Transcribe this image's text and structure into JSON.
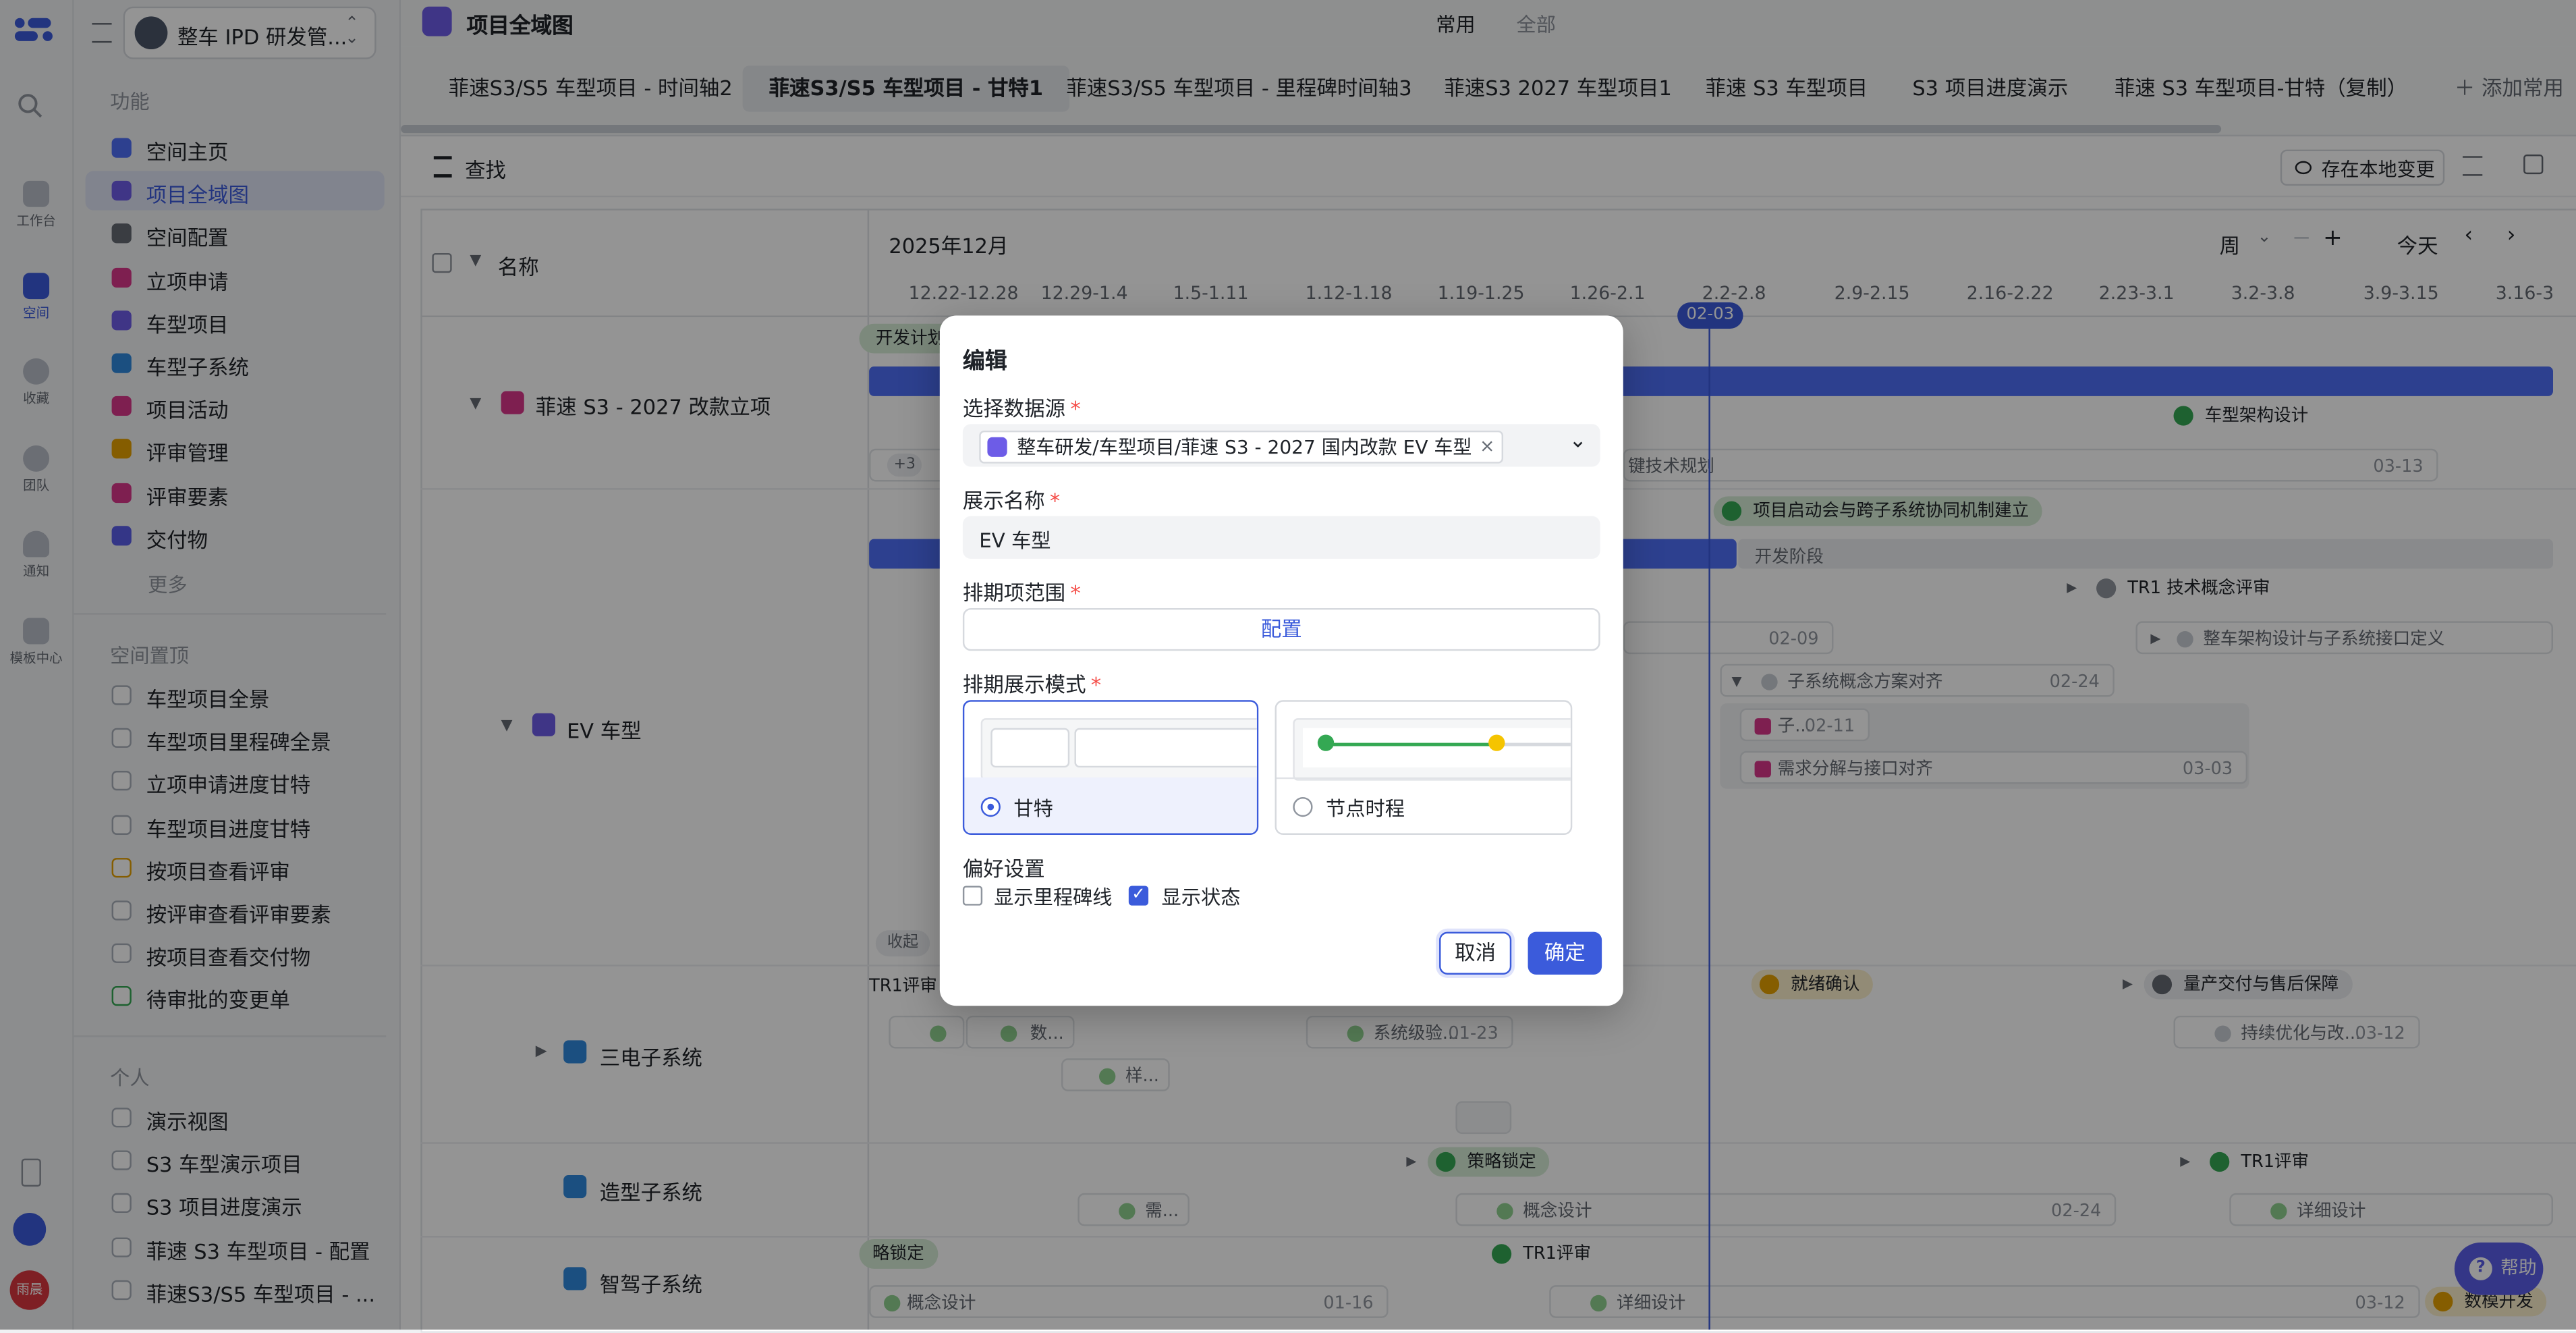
{
  "rail": {
    "items": [
      {
        "label": "工作台",
        "icon": "home-icon"
      },
      {
        "label": "空间",
        "icon": "space-icon"
      },
      {
        "label": "收藏",
        "icon": "star-icon"
      },
      {
        "label": "团队",
        "icon": "team-icon"
      },
      {
        "label": "通知",
        "icon": "bell-icon"
      },
      {
        "label": "模板中心",
        "icon": "template-icon"
      }
    ],
    "avatar": "雨晨"
  },
  "sidebar": {
    "space_name": "整车 IPD 研发管...",
    "features_title": "功能",
    "features": [
      {
        "label": "空间主页",
        "color": "#4f6ef7"
      },
      {
        "label": "项目全域图",
        "color": "#6d5ce7"
      },
      {
        "label": "空间配置",
        "color": "#646a73"
      },
      {
        "label": "立项申请",
        "color": "#d9368b"
      },
      {
        "label": "车型项目",
        "color": "#6d5ce7"
      },
      {
        "label": "车型子系统",
        "color": "#2f88dc"
      },
      {
        "label": "项目活动",
        "color": "#d9368b"
      },
      {
        "label": "评审管理",
        "color": "#e5a000"
      },
      {
        "label": "评审要素",
        "color": "#d9368b"
      },
      {
        "label": "交付物",
        "color": "#5b5ee8"
      }
    ],
    "more": "更多",
    "pinned_title": "空间置顶",
    "pinned": [
      "车型项目全景",
      "车型项目里程碑全景",
      "立项申请进度甘特",
      "车型项目进度甘特",
      "按项目查看评审",
      "按评审查看评审要素",
      "按项目查看交付物",
      "待审批的变更单"
    ],
    "personal_title": "个人",
    "personal": [
      "演示视图",
      "S3 车型演示项目",
      "S3 项目进度演示",
      "菲速 S3 车型项目 - 配置",
      "菲速S3/S5 车型项目 - ..."
    ]
  },
  "page": {
    "title": "项目全域图",
    "tab_common": "常用",
    "tab_all": "全部",
    "view_tabs": [
      "菲速S3/S5 车型项目 - 时间轴2",
      "菲速S3/S5 车型项目 - 甘特1",
      "菲速S3/S5 车型项目 - 里程碑时间轴3",
      "菲速S3 2027 车型项目1",
      "菲速 S3 车型项目",
      "S3 项目进度演示",
      "菲速 S3 车型项目-甘特（复制）"
    ],
    "add_common": "添加常用",
    "search": "查找",
    "save_local": "存在本地变更"
  },
  "gantt": {
    "name_header": "名称",
    "month": "2025年12月",
    "unit": "周",
    "today": "今天",
    "weeks": [
      "12.22-12.28",
      "12.29-1.4",
      "1.5-1.11",
      "1.12-1.18",
      "1.19-1.25",
      "1.26-2.1",
      "2.2-2.8",
      "2.9-2.15",
      "2.16-2.22",
      "2.23-3.1",
      "3.2-3.8",
      "3.9-3.15",
      "3.16-3"
    ],
    "today_marker": "02-03",
    "rows": {
      "project": "菲速 S3 - 2027 改款立项",
      "ev": "EV 车型",
      "sys1": "三电子系统",
      "sys2": "造型子系统",
      "sys3": "智驾子系统"
    },
    "items": {
      "dev_plan": "开发计划",
      "arch_design": "车型架构设计",
      "plus3": "+3",
      "key_tech": "键技术规划",
      "date_0313": "03-13",
      "kickoff": "项目启动会与跨子系统协同机制建立",
      "dev_stage": "开发阶段",
      "tr1_concept": "TR1 技术概念评审",
      "date_0209": "02-09",
      "arch_interface": "整车架构设计与子系统接口定义",
      "subsys_concept": "子系统概念方案对齐",
      "date_0224": "02-24",
      "sub_short": "子...",
      "date_0211": "02-11",
      "req_decomp": "需求分解与接口对齐",
      "date_0303": "03-03",
      "collapse": "收起",
      "tr1_review": "TR1评审",
      "ready_confirm": "就绪确认",
      "mass_delivery": "量产交付与售后保障",
      "data_short": "数...",
      "sys_verify": "系统级验...",
      "date_0123": "01-23",
      "continuous_opt": "持续优化与改...",
      "date_0312": "03-12",
      "sample_short": "样...",
      "strategy_lock": "策略锁定",
      "tr1_review2": "TR1评审",
      "need_short": "需...",
      "concept_design": "概念设计",
      "detail_design": "详细设计",
      "lock_short": "略锁定",
      "tr1_review3": "TR1评审",
      "concept_design2": "概念设计",
      "date_0116": "01-16",
      "detail_design2": "详细设计",
      "date_0312b": "03-12",
      "data_dev": "数模开发"
    }
  },
  "modal": {
    "title": "编辑",
    "datasource_label": "选择数据源",
    "datasource_value": "整车研发/车型项目/菲速 S3 - 2027 国内改款 EV 车型",
    "display_name_label": "展示名称",
    "display_name_value": "EV 车型",
    "range_label": "排期项范围",
    "configure": "配置",
    "mode_label": "排期展示模式",
    "mode_gantt": "甘特",
    "mode_timeline": "节点时程",
    "pref_label": "偏好设置",
    "show_milestone": "显示里程碑线",
    "show_status": "显示状态",
    "cancel": "取消",
    "confirm": "确定"
  },
  "help": "帮助"
}
